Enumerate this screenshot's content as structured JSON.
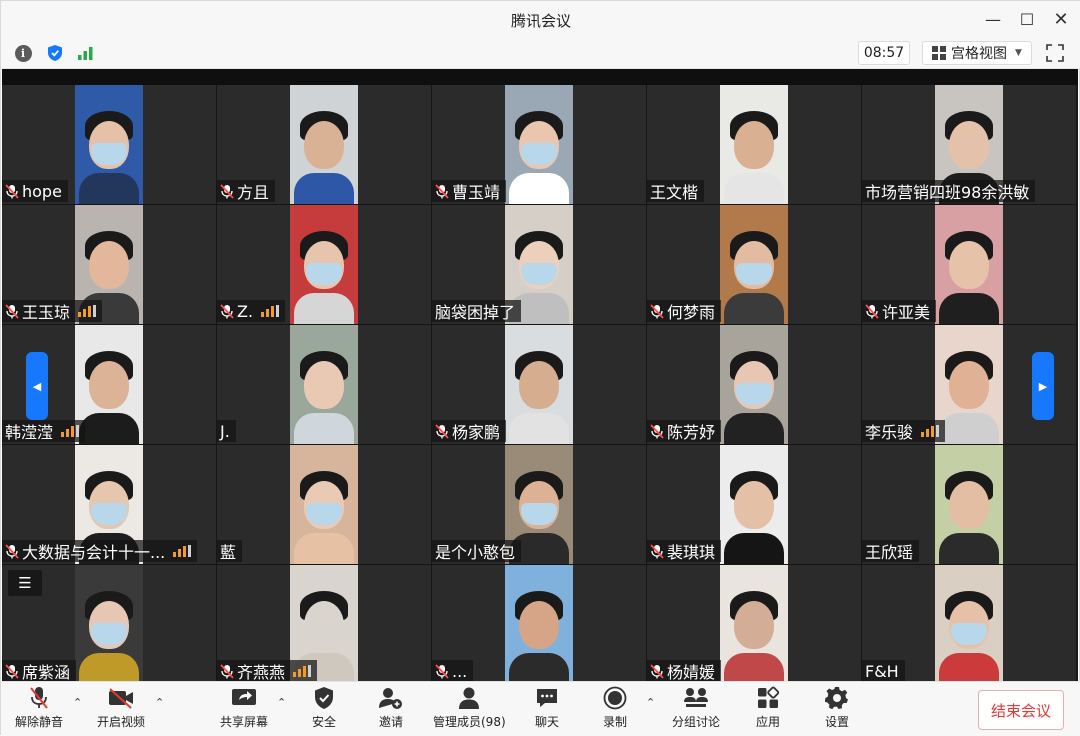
{
  "window": {
    "title": "腾讯会议"
  },
  "infobar": {
    "timer": "08:57",
    "view_mode": "宫格视图"
  },
  "participants": [
    {
      "name": "hope",
      "mic_muted": true,
      "signal": false,
      "cam": {
        "bg": "#2f5aa8",
        "skin": "#e7c1a7",
        "mask": true,
        "body": "#23365c"
      }
    },
    {
      "name": "方且",
      "mic_muted": true,
      "signal": false,
      "cam": {
        "bg": "#cfd3d6",
        "skin": "#d9b295",
        "mask": false,
        "body": "#2e57a8"
      }
    },
    {
      "name": "曹玉靖",
      "mic_muted": true,
      "signal": false,
      "cam": {
        "bg": "#9aa8b6",
        "skin": "#e9c6ad",
        "mask": true,
        "body": "#ffffff"
      }
    },
    {
      "name": "王文楷",
      "mic_muted": false,
      "signal": false,
      "cam": {
        "bg": "#e9e9e6",
        "skin": "#d9b092",
        "mask": false,
        "body": "#e5e5e5"
      }
    },
    {
      "name": "市场营销四班98余洪敏",
      "mic_muted": false,
      "signal": false,
      "cam": {
        "bg": "#c8c4c0",
        "skin": "#e4c2aa",
        "mask": false,
        "body": "#1e1e1e"
      }
    },
    {
      "name": "王玉琼",
      "mic_muted": true,
      "signal": true,
      "cam": {
        "bg": "#b9b4b0",
        "skin": "#e2b79b",
        "mask": false,
        "body": "#3a3a3a"
      }
    },
    {
      "name": "Z.",
      "mic_muted": true,
      "signal": true,
      "cam": {
        "bg": "#c63b3b",
        "skin": "#e6c4ae",
        "mask": true,
        "body": "#d6d6d6"
      }
    },
    {
      "name": "脑袋困掉了",
      "mic_muted": false,
      "signal": false,
      "cam": {
        "bg": "#d6cfc7",
        "skin": "#ecd0bc",
        "mask": true,
        "body": "#bfbfbf"
      }
    },
    {
      "name": "何梦雨",
      "mic_muted": true,
      "signal": false,
      "cam": {
        "bg": "#b27a4a",
        "skin": "#e2bba1",
        "mask": true,
        "body": "#3b3b3b"
      }
    },
    {
      "name": "许亚美",
      "mic_muted": true,
      "signal": false,
      "cam": {
        "bg": "#d9a0a3",
        "skin": "#e6c2a9",
        "mask": false,
        "body": "#1f1f1f"
      }
    },
    {
      "name": "韩滢滢",
      "mic_muted": false,
      "signal": true,
      "cam": {
        "bg": "#e8e8e8",
        "skin": "#dcb397",
        "mask": false,
        "body": "#1c1c1c"
      }
    },
    {
      "name": "J.",
      "mic_muted": false,
      "signal": false,
      "cam": {
        "bg": "#9aa79b",
        "skin": "#e9c9b4",
        "mask": false,
        "body": "#cfd7dc"
      }
    },
    {
      "name": "杨家鹏",
      "mic_muted": true,
      "signal": false,
      "cam": {
        "bg": "#d9dde0",
        "skin": "#d7ad90",
        "mask": false,
        "body": "#e2e2e2"
      }
    },
    {
      "name": "陈芳妤",
      "mic_muted": true,
      "signal": false,
      "cam": {
        "bg": "#a9a49b",
        "skin": "#e7c7b1",
        "mask": true,
        "body": "#222222"
      }
    },
    {
      "name": "李乐骏",
      "mic_muted": false,
      "signal": true,
      "cam": {
        "bg": "#e8d6cc",
        "skin": "#e0b194",
        "mask": false,
        "body": "#cfcfcf"
      }
    },
    {
      "name": "大数据与会计十一...",
      "mic_muted": true,
      "signal": true,
      "cam": {
        "bg": "#ece9e4",
        "skin": "#e6c6ad",
        "mask": true,
        "body": "#1e1e1e"
      }
    },
    {
      "name": "藍",
      "mic_muted": false,
      "signal": false,
      "cam": {
        "bg": "#d7b49c",
        "skin": "#e9cab4",
        "mask": true,
        "body": "#e7c1a4"
      }
    },
    {
      "name": "是个小憨包",
      "mic_muted": false,
      "signal": false,
      "cam": {
        "bg": "#9a8a78",
        "skin": "#dcb194",
        "mask": true,
        "body": "#2a2a2a"
      }
    },
    {
      "name": "裴琪琪",
      "mic_muted": true,
      "signal": false,
      "cam": {
        "bg": "#ececec",
        "skin": "#e4c0a6",
        "mask": false,
        "body": "#151515"
      }
    },
    {
      "name": "王欣瑶",
      "mic_muted": false,
      "signal": false,
      "cam": {
        "bg": "#c4cfa6",
        "skin": "#e4bea3",
        "mask": false,
        "body": "#2b2b2b"
      }
    },
    {
      "name": "席紫涵",
      "mic_muted": true,
      "signal": false,
      "cam": {
        "bg": "#3a3a3a",
        "skin": "#e6c7b3",
        "mask": true,
        "body": "#c09a28"
      }
    },
    {
      "name": "齐燕燕",
      "mic_muted": true,
      "signal": true,
      "cam": {
        "bg": "#d9d4cd",
        "skin": "#d9d4cd",
        "mask": false,
        "body": "#cfc8bf"
      }
    },
    {
      "name": "...",
      "mic_muted": true,
      "signal": false,
      "cam": {
        "bg": "#7fb1dc",
        "skin": "#d6a587",
        "mask": false,
        "body": "#2b2b2b"
      }
    },
    {
      "name": "杨婧媛",
      "mic_muted": true,
      "signal": false,
      "cam": {
        "bg": "#e9e4dd",
        "skin": "#d3ad95",
        "mask": false,
        "body": "#c04848"
      }
    },
    {
      "name": "F&H",
      "mic_muted": false,
      "signal": false,
      "cam": {
        "bg": "#d9d0c3",
        "skin": "#e6c1a7",
        "mask": true,
        "body": "#cc3b3b"
      }
    }
  ],
  "toolbar": {
    "unmute": "解除静音",
    "start_video": "开启视频",
    "share_screen": "共享屏幕",
    "security": "安全",
    "invite": "邀请",
    "manage_members": "管理成员(98)",
    "chat": "聊天",
    "record": "录制",
    "breakout": "分组讨论",
    "apps": "应用",
    "settings": "设置",
    "end_meeting": "结束会议"
  },
  "colors": {
    "accent": "#1677ff",
    "end": "#e53935",
    "signal": "#f39a2b"
  }
}
